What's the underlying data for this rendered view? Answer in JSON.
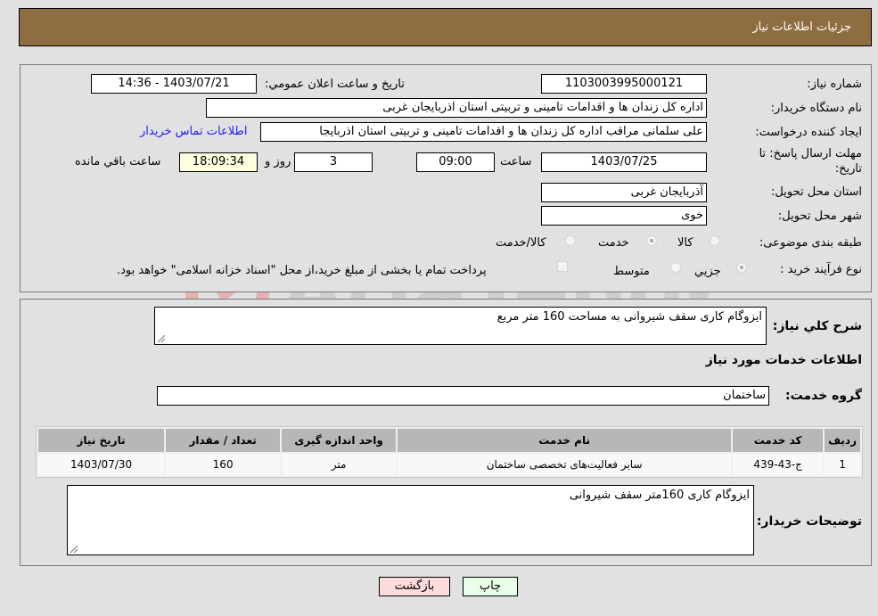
{
  "header": {
    "title": "جزئیات اطلاعات نیاز"
  },
  "form": {
    "need_number": {
      "label": "شماره نیاز:",
      "value": "1103003995000121"
    },
    "announce_datetime": {
      "label": "تاریخ و ساعت اعلان عمومي:",
      "value": "1403/07/21 - 14:36"
    },
    "buyer_org": {
      "label": "نام دستگاه خریدار:",
      "value": "اداره کل زندان ها و اقدامات تامینی و تربیتی استان اذربایجان غربی"
    },
    "requester": {
      "label": "ایجاد کننده درخواست:",
      "value": "علی سلمانی مراقب اداره کل زندان ها و اقدامات تامینی و تربیتی استان اذربایجا",
      "contact_link": "اطلاعات تماس خریدار"
    },
    "deadline": {
      "label_line1": "مهلت ارسال پاسخ: تا",
      "label_line2": "تاریخ:",
      "date": "1403/07/25",
      "time_label": "ساعت",
      "time": "09:00",
      "days": "3",
      "days_label": "روز و",
      "remaining": "18:09:34",
      "remaining_label": "ساعت باقي مانده"
    },
    "province": {
      "label": "استان محل تحویل:",
      "value": "آذربایجان غربی"
    },
    "city": {
      "label": "شهر محل تحویل:",
      "value": "خوی"
    },
    "category": {
      "label": "طبقه بندی موضوعی:",
      "options": [
        {
          "label": "کالا",
          "selected": false
        },
        {
          "label": "خدمت",
          "selected": true
        },
        {
          "label": "کالا/خدمت",
          "selected": false
        }
      ]
    },
    "process": {
      "label": "نوع فرآیند خرید :",
      "options": [
        {
          "label": "جزيي",
          "selected": true
        },
        {
          "label": "متوسط",
          "selected": false
        }
      ],
      "treasury_checkbox": {
        "label": "پرداخت تمام یا بخشی از مبلغ خرید،از محل \"اسناد خزانه اسلامی\" خواهد بود.",
        "checked": false
      }
    }
  },
  "details": {
    "description": {
      "label": "شرح کلي نياز:",
      "value": "ایزوگام کاری سقف شیروانی به مساحت 160 متر مربع"
    },
    "services_heading": "اطلاعات خدمات مورد نیاز",
    "service_group": {
      "label": "گروه خدمت:",
      "value": "ساختمان"
    },
    "table": {
      "headers": [
        "ردیف",
        "کد خدمت",
        "نام خدمت",
        "واحد اندازه گیری",
        "تعداد / مقدار",
        "تاریخ نیاز"
      ],
      "rows": [
        [
          "1",
          "ج-43-439",
          "سایر فعالیت‌های تخصصی ساختمان",
          "متر",
          "160",
          "1403/07/30"
        ]
      ]
    },
    "buyer_notes": {
      "label": "توضیحات خریدار:",
      "value": "ایزوگام کاری 160متر سقف شیروانی"
    }
  },
  "buttons": {
    "print": "چاپ",
    "back": "بازگشت"
  },
  "watermark": {
    "text": "AriaTender.neT"
  },
  "colors": {
    "header": "#8e6d41",
    "print_bg": "#e8ffe8",
    "back_bg": "#ffdcdc",
    "link": "#1a1aff"
  }
}
